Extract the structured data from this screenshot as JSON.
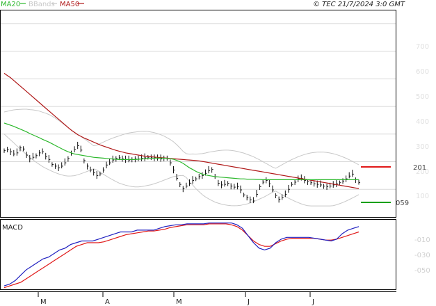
{
  "legend": {
    "items": [
      {
        "label": "MA20",
        "color": "#2cb82c"
      },
      {
        "label": "BBands",
        "color": "#c8c8c8"
      },
      {
        "label": "MA50",
        "color": "#b01818"
      }
    ]
  },
  "copyright": "© TEC 21/7/2024 3:0 GMT",
  "macd_label": "MACD",
  "price_axis": [
    "700",
    "600",
    "500",
    "400",
    "300",
    "200",
    "100"
  ],
  "macd_axis": [
    "-010",
    "-030",
    "-050"
  ],
  "months": [
    "M",
    "A",
    "M",
    "J",
    "J"
  ],
  "markers": {
    "resistance": {
      "label": "201",
      "color": "#e01818"
    },
    "support": {
      "label": "059",
      "color": "#18a018"
    }
  },
  "colors": {
    "ma20": "#2cb82c",
    "ma50": "#b01818",
    "bbands": "#c8c8c8",
    "macd_line": "#2020c0",
    "signal_line": "#e01818",
    "price_bars": "#101010",
    "grid": "#d8d8d8"
  },
  "chart_data": {
    "type": "line",
    "price_ylim": [
      0,
      750
    ],
    "x_count": 112,
    "ma20": [
      340,
      336,
      332,
      328,
      323,
      318,
      313,
      308,
      302,
      297,
      292,
      287,
      281,
      276,
      271,
      265,
      259,
      253,
      247,
      241,
      236,
      232,
      228,
      226,
      224,
      222,
      220,
      218,
      216,
      215,
      214,
      213,
      212,
      211,
      210,
      209,
      208,
      208,
      208,
      208,
      208,
      208,
      209,
      210,
      211,
      212,
      212,
      213,
      213,
      213,
      213,
      212,
      211,
      209,
      205,
      200,
      194,
      186,
      178,
      172,
      165,
      160,
      155,
      152,
      150,
      148,
      146,
      145,
      144,
      143,
      142,
      141,
      140,
      139,
      138,
      138,
      137,
      137,
      137,
      136,
      136,
      135,
      135,
      135,
      135,
      135,
      135,
      135,
      135,
      135,
      135,
      135,
      135,
      135,
      135,
      135,
      135,
      135,
      135,
      135,
      135,
      135,
      135,
      135,
      135,
      135,
      135,
      135,
      135,
      135,
      135,
      135
    ],
    "ma50": [
      520,
      512,
      504,
      494,
      484,
      474,
      464,
      454,
      444,
      434,
      424,
      414,
      404,
      394,
      384,
      374,
      364,
      354,
      344,
      334,
      324,
      314,
      306,
      298,
      292,
      286,
      281,
      276,
      271,
      266,
      261,
      257,
      253,
      249,
      245,
      241,
      238,
      235,
      232,
      230,
      228,
      226,
      224,
      222,
      220,
      219,
      218,
      217,
      216,
      215,
      214,
      213,
      212,
      211,
      210,
      209,
      208,
      207,
      206,
      205,
      204,
      203,
      201,
      199,
      197,
      195,
      193,
      191,
      189,
      187,
      185,
      183,
      181,
      179,
      177,
      175,
      173,
      171,
      169,
      167,
      165,
      163,
      161,
      159,
      157,
      155,
      153,
      151,
      149,
      147,
      145,
      143,
      141,
      139,
      137,
      135,
      133,
      131,
      129,
      127,
      125,
      123,
      121,
      119,
      117,
      115,
      113,
      111,
      109,
      107,
      105,
      103
    ],
    "price_closes": [
      240,
      244,
      236,
      228,
      232,
      250,
      246,
      224,
      210,
      216,
      222,
      232,
      236,
      218,
      208,
      190,
      184,
      178,
      184,
      196,
      212,
      230,
      244,
      258,
      242,
      204,
      184,
      170,
      160,
      150,
      156,
      170,
      188,
      196,
      206,
      212,
      214,
      210,
      208,
      206,
      208,
      210,
      210,
      212,
      214,
      216,
      216,
      214,
      212,
      210,
      214,
      212,
      196,
      170,
      140,
      118,
      102,
      112,
      122,
      132,
      138,
      146,
      150,
      158,
      168,
      172,
      146,
      122,
      116,
      118,
      122,
      112,
      108,
      110,
      98,
      80,
      70,
      62,
      58,
      82,
      110,
      126,
      132,
      120,
      98,
      78,
      64,
      70,
      82,
      100,
      118,
      126,
      138,
      140,
      132,
      128,
      124,
      120,
      118,
      116,
      112,
      110,
      112,
      116,
      120,
      124,
      130,
      138,
      148,
      155,
      135,
      125
    ],
    "macd_label": "MACD",
    "macd_ylim": [
      -75,
      0
    ],
    "macd": [
      -72,
      -70,
      -66,
      -60,
      -54,
      -50,
      -46,
      -42,
      -40,
      -36,
      -32,
      -30,
      -26,
      -24,
      -22,
      -22,
      -22,
      -20,
      -18,
      -16,
      -14,
      -12,
      -12,
      -12,
      -10,
      -10,
      -10,
      -10,
      -8,
      -6,
      -5,
      -4,
      -4,
      -3,
      -3,
      -3,
      -3,
      -2,
      -2,
      -2,
      -2,
      -2,
      -4,
      -8,
      -16,
      -24,
      -30,
      -32,
      -30,
      -24,
      -20,
      -18,
      -18,
      -18,
      -18,
      -18,
      -19,
      -20,
      -21,
      -22,
      -20,
      -14,
      -10,
      -8,
      -6
    ],
    "signal": [
      -74,
      -72,
      -70,
      -68,
      -64,
      -60,
      -56,
      -52,
      -48,
      -44,
      -40,
      -36,
      -32,
      -28,
      -26,
      -24,
      -24,
      -24,
      -23,
      -21,
      -19,
      -17,
      -15,
      -14,
      -13,
      -12,
      -11,
      -11,
      -10,
      -9,
      -7,
      -6,
      -5,
      -4,
      -4,
      -4,
      -4,
      -3,
      -3,
      -3,
      -3,
      -4,
      -6,
      -10,
      -16,
      -22,
      -26,
      -28,
      -28,
      -25,
      -22,
      -20,
      -19,
      -19,
      -19,
      -19,
      -19,
      -20,
      -21,
      -21,
      -20,
      -18,
      -16,
      -14,
      -12
    ]
  }
}
